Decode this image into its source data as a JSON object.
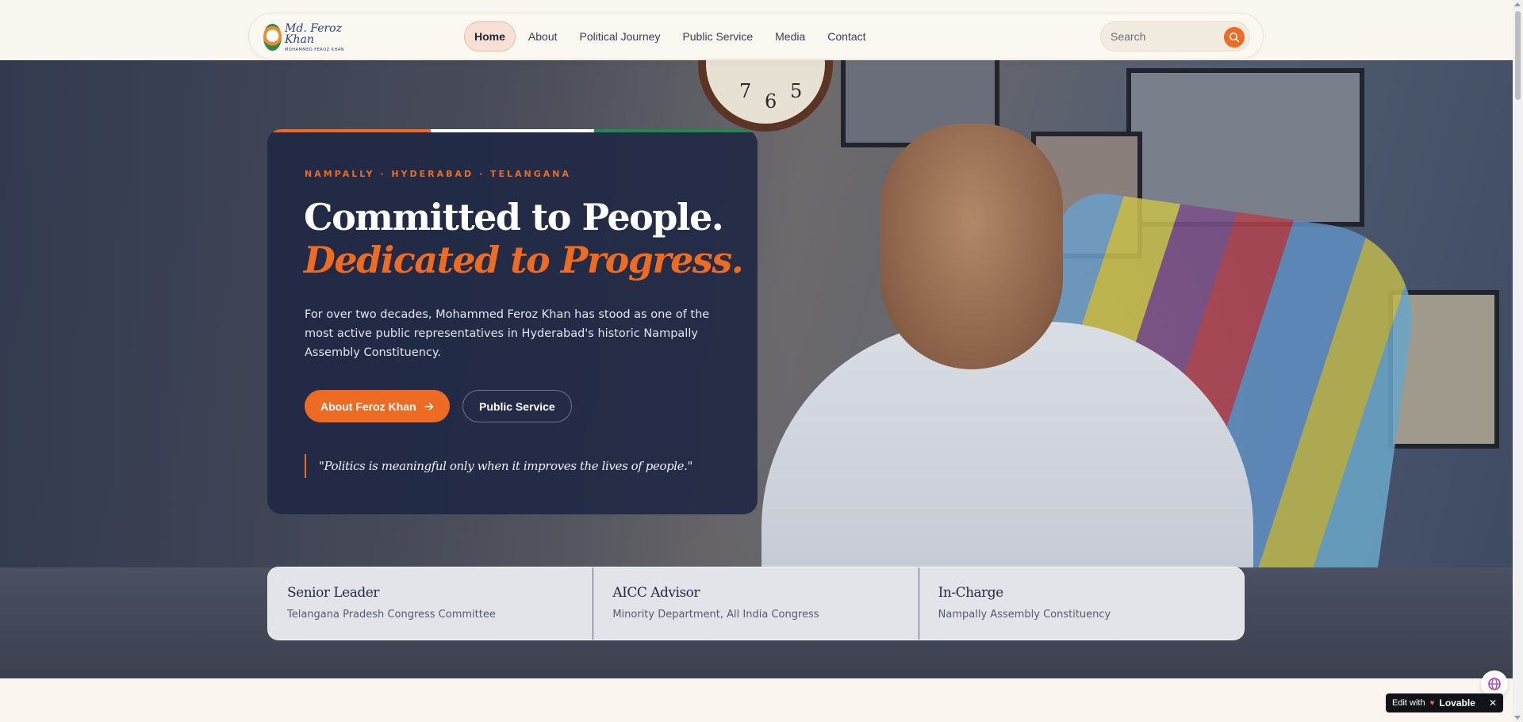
{
  "header": {
    "logo": {
      "signature": "Md. Feroz Khan",
      "subtitle": "MOHAMMED FEROZ KHAN"
    },
    "nav": [
      {
        "label": "Home",
        "active": true
      },
      {
        "label": "About",
        "active": false
      },
      {
        "label": "Political Journey",
        "active": false
      },
      {
        "label": "Public Service",
        "active": false
      },
      {
        "label": "Media",
        "active": false
      },
      {
        "label": "Contact",
        "active": false
      }
    ],
    "search": {
      "placeholder": "Search",
      "icon": "search-icon"
    }
  },
  "hero": {
    "eyebrow": "NAMPALLY · HYDERABAD · TELANGANA",
    "headline_line1": "Committed to People.",
    "headline_line2": "Dedicated to Progress.",
    "lead": "For over two decades, Mohammed Feroz Khan has stood as one of the most active public representatives in Hyderabad's historic Nampally Assembly Constituency.",
    "primary_cta": "About Feroz Khan",
    "primary_cta_icon": "arrow-right-icon",
    "secondary_cta": "Public Service",
    "quote": "\"Politics is meaningful only when it improves the lives of people.\"",
    "clock_numerals": [
      "7",
      "6",
      "5"
    ]
  },
  "stats": [
    {
      "title": "Senior Leader",
      "desc": "Telangana Pradesh Congress Committee"
    },
    {
      "title": "AICC Advisor",
      "desc": "Minority Department, All India Congress"
    },
    {
      "title": "In-Charge",
      "desc": "Nampally Assembly Constituency"
    }
  ],
  "badge": {
    "prefix": "Edit with",
    "brand": "Lovable",
    "close_icon": "close-icon"
  },
  "colors": {
    "accent": "#ed6b22",
    "card_bg": "#1f2844",
    "tricolor": [
      "#ed6b22",
      "#ffffff",
      "#1f8a4c"
    ]
  }
}
